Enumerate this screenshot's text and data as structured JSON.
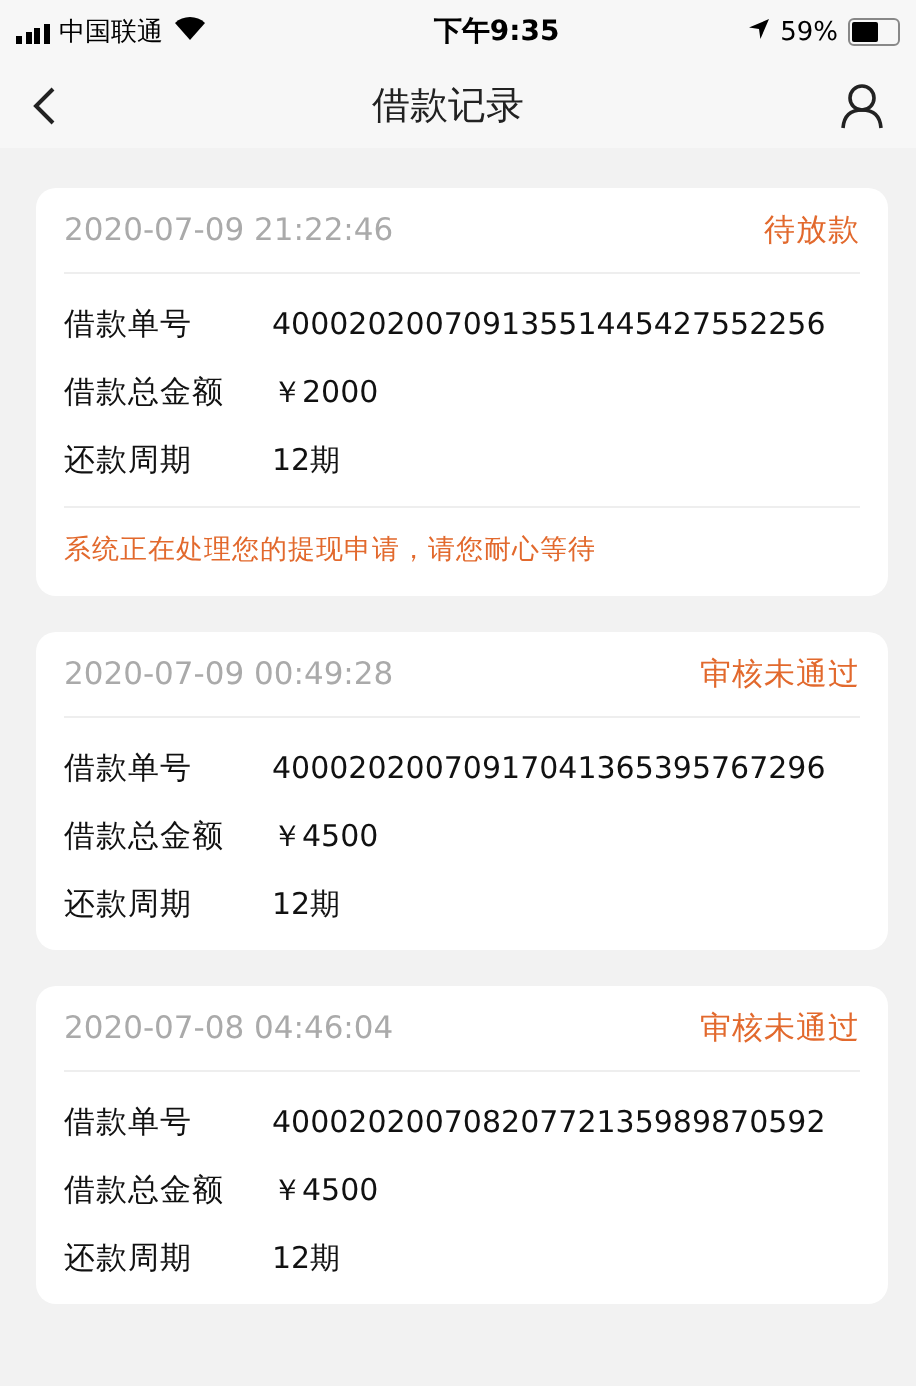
{
  "status_bar": {
    "carrier": "中国联通",
    "time": "下午9:35",
    "battery": "59%"
  },
  "header": {
    "title": "借款记录"
  },
  "records": [
    {
      "datetime": "2020-07-09 21:22:46",
      "status": "待放款",
      "fields": [
        {
          "label": "借款单号",
          "value": "40002020070913551445427552256"
        },
        {
          "label": "借款总金额",
          "value": "￥2000"
        },
        {
          "label": "还款周期",
          "value": "12期"
        }
      ],
      "note": "系统正在处理您的提现申请，请您耐心等待"
    },
    {
      "datetime": "2020-07-09 00:49:28",
      "status": "审核未通过",
      "fields": [
        {
          "label": "借款单号",
          "value": "40002020070917041365395767296"
        },
        {
          "label": "借款总金额",
          "value": "￥4500"
        },
        {
          "label": "还款周期",
          "value": "12期"
        }
      ]
    },
    {
      "datetime": "2020-07-08 04:46:04",
      "status": "审核未通过",
      "fields": [
        {
          "label": "借款单号",
          "value": "40002020070820772135989870592"
        },
        {
          "label": "借款总金额",
          "value": "￥4500"
        },
        {
          "label": "还款周期",
          "value": "12期"
        }
      ]
    }
  ]
}
